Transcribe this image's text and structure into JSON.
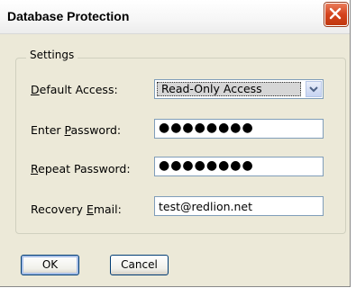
{
  "window": {
    "title": "Database Protection"
  },
  "settings": {
    "legend": "Settings",
    "default_access": {
      "label_prefix": "",
      "label_accel": "D",
      "label_rest": "efault Access:",
      "value": "Read-Only Access"
    },
    "enter_password": {
      "label_prefix": "Enter ",
      "label_accel": "P",
      "label_rest": "assword:",
      "value": "●●●●●●●●"
    },
    "repeat_password": {
      "label_prefix": "",
      "label_accel": "R",
      "label_rest": "epeat Password:",
      "value": "●●●●●●●●"
    },
    "recovery_email": {
      "label_prefix": "Recovery ",
      "label_accel": "E",
      "label_rest": "mail:",
      "value": "test@redlion.net"
    }
  },
  "buttons": {
    "ok": "OK",
    "cancel": "Cancel"
  },
  "icons": {
    "close": "close-icon",
    "dropdown": "chevron-down-icon"
  },
  "colors": {
    "close_button": "#d5431d",
    "field_border": "#7f9db9",
    "dialog_bg": "#ece9d8"
  }
}
